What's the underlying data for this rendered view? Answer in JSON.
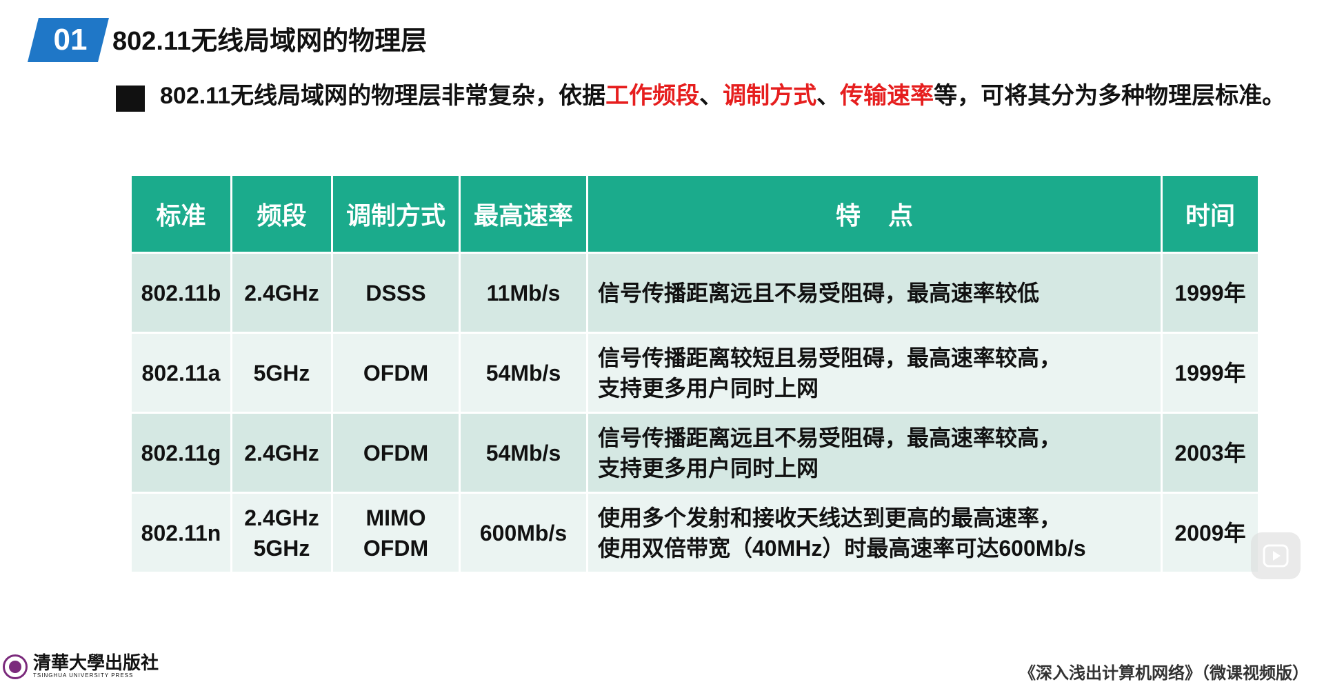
{
  "header": {
    "section_number": "01",
    "title": "802.11无线局域网的物理层"
  },
  "intro": {
    "part1": "802.11无线局域网的物理层非常复杂，依据",
    "hl1": "工作频段",
    "sep1": "、",
    "hl2": "调制方式",
    "sep2": "、",
    "hl3": "传输速率",
    "part2": "等，可将其分为多种物理层标准。"
  },
  "table": {
    "headers": [
      "标准",
      "频段",
      "调制方式",
      "最高速率",
      "特    点",
      "时间"
    ],
    "rows": [
      {
        "standard": "802.11b",
        "band": [
          "2.4GHz"
        ],
        "modulation": [
          "DSSS"
        ],
        "max_rate": "11Mb/s",
        "features": [
          "信号传播距离远且不易受阻碍，最高速率较低"
        ],
        "year": "1999年"
      },
      {
        "standard": "802.11a",
        "band": [
          "5GHz"
        ],
        "modulation": [
          "OFDM"
        ],
        "max_rate": "54Mb/s",
        "features": [
          "信号传播距离较短且易受阻碍，最高速率较高，",
          "支持更多用户同时上网"
        ],
        "year": "1999年"
      },
      {
        "standard": "802.11g",
        "band": [
          "2.4GHz"
        ],
        "modulation": [
          "OFDM"
        ],
        "max_rate": "54Mb/s",
        "features": [
          "信号传播距离远且不易受阻碍，最高速率较高，",
          "支持更多用户同时上网"
        ],
        "year": "2003年"
      },
      {
        "standard": "802.11n",
        "band": [
          "2.4GHz",
          "5GHz"
        ],
        "modulation": [
          "MIMO",
          "OFDM"
        ],
        "max_rate": "600Mb/s",
        "features": [
          "使用多个发射和接收天线达到更高的最高速率，",
          "使用双倍带宽（40MHz）时最高速率可达600Mb/s"
        ],
        "year": "2009年"
      }
    ]
  },
  "logo": {
    "cn": "清華大學出版社",
    "en": "TSINGHUA UNIVERSITY PRESS"
  },
  "footer": {
    "text": "《深入浅出计算机网络》（微课视频版）"
  },
  "colors": {
    "badge": "#1f77c7",
    "header_bg": "#1bab8c",
    "row_odd": "#d5e8e3",
    "row_even": "#ebf4f2",
    "highlight": "#e61e1e"
  },
  "icons": {
    "play": "play-icon"
  }
}
